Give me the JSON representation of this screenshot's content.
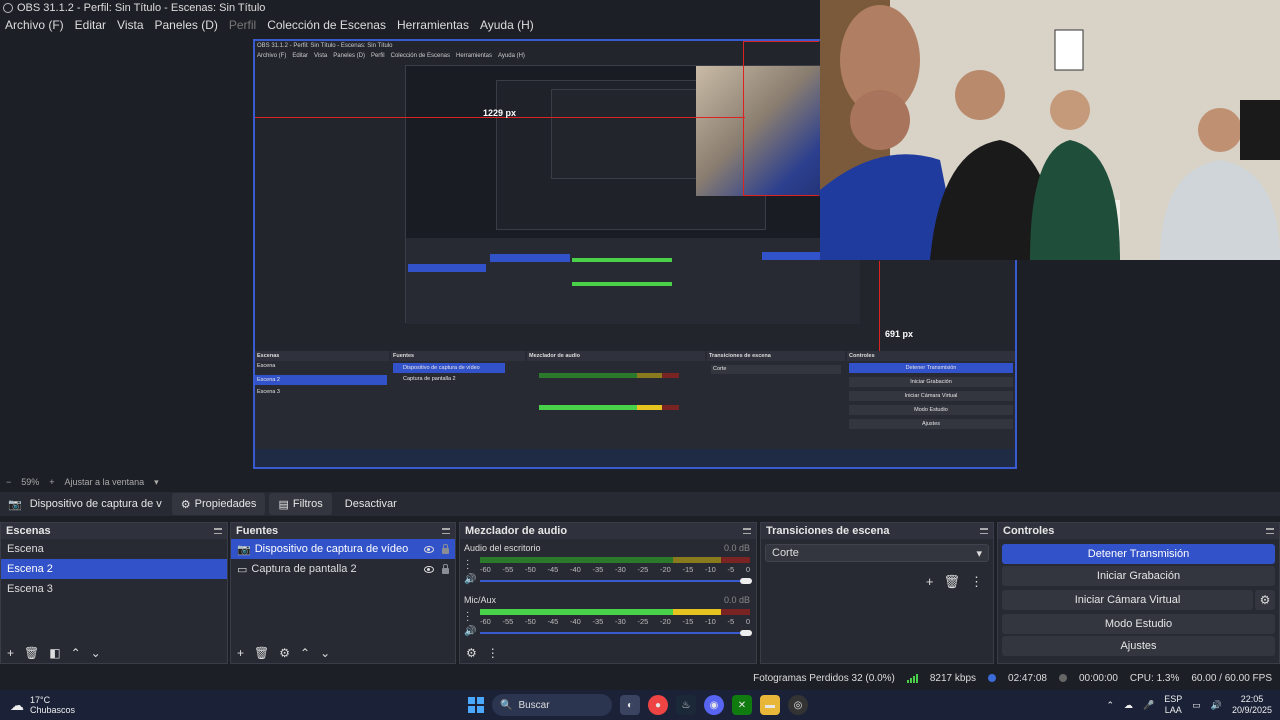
{
  "window": {
    "title": "OBS 31.1.2 - Perfil: Sin Título - Escenas: Sin Título"
  },
  "menu": [
    "Archivo (F)",
    "Editar",
    "Vista",
    "Paneles (D)",
    "Perfil",
    "Colección de Escenas",
    "Herramientas",
    "Ayuda (H)"
  ],
  "preview": {
    "inner_title": "OBS 31.1.2 - Perfil: Sin Título - Escenas: Sin Título",
    "inner_menu": [
      "Archivo (F)",
      "Editar",
      "Vista",
      "Paneles (D)",
      "Perfil",
      "Colección de Escenas",
      "Herramientas",
      "Ayuda (H)"
    ],
    "width_label": "1229 px",
    "height_label": "691 px"
  },
  "zoom": {
    "value": "59%",
    "fit_label": "Ajustar a la ventana"
  },
  "source_toolbar": {
    "source": "Dispositivo de captura de v",
    "properties": "Propiedades",
    "filters": "Filtros",
    "deactivate": "Desactivar"
  },
  "scenes": {
    "title": "Escenas",
    "items": [
      "Escena",
      "Escena 2",
      "Escena 3"
    ],
    "selected_index": 1
  },
  "sources": {
    "title": "Fuentes",
    "items": [
      {
        "label": "Dispositivo de captura de vídeo",
        "icon": "camera-icon"
      },
      {
        "label": "Captura de pantalla 2",
        "icon": "monitor-icon"
      }
    ]
  },
  "mixer": {
    "title": "Mezclador de audio",
    "channels": [
      {
        "name": "Audio del escritorio",
        "db": "0.0 dB",
        "level": 0
      },
      {
        "name": "Mic/Aux",
        "db": "0.0 dB",
        "level": 0.9
      }
    ],
    "scale": [
      "-60",
      "-55",
      "-50",
      "-45",
      "-40",
      "-35",
      "-30",
      "-25",
      "-20",
      "-15",
      "-10",
      "-5",
      "0"
    ]
  },
  "transitions": {
    "title": "Transiciones de escena",
    "selected": "Corte"
  },
  "controls": {
    "title": "Controles",
    "stop_stream": "Detener Transmisión",
    "start_recording": "Iniciar Grabación",
    "start_virtual_cam": "Iniciar Cámara Virtual",
    "studio_mode": "Modo Estudio",
    "settings": "Ajustes"
  },
  "status": {
    "dropped_frames": "Fotogramas Perdidos 32 (0.0%)",
    "bitrate": "8217 kbps",
    "stream_time": "02:47:08",
    "rec_time": "00:00:00",
    "cpu": "CPU: 1.3%",
    "fps": "60.00 / 60.00 FPS"
  },
  "taskbar": {
    "temp": "17°C",
    "weather": "Chubascos",
    "search": "Buscar",
    "lang": "ESP",
    "layout": "LAA",
    "time": "22:05",
    "date": "20/9/2025"
  },
  "colors": {
    "accent": "#3252c9",
    "measure": "#dd2222"
  }
}
